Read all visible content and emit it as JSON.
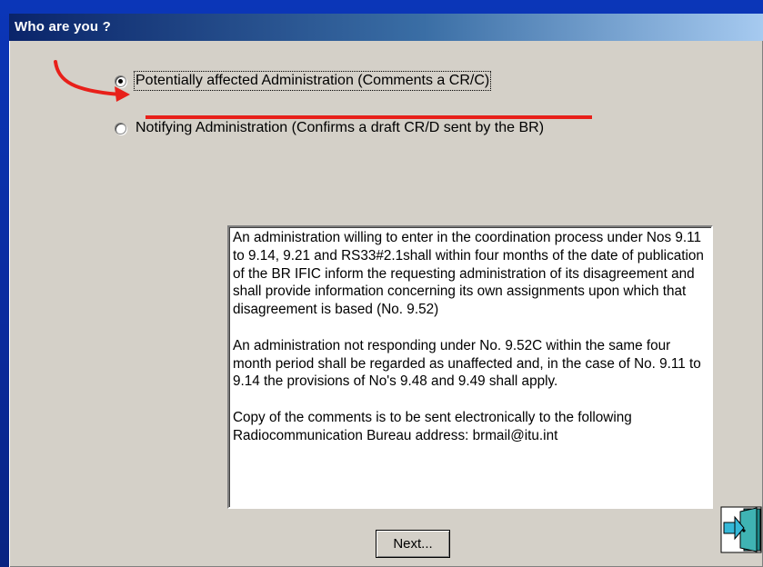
{
  "dialog": {
    "title": "Who are you ?"
  },
  "options": [
    {
      "label": "Potentially affected Administration (Comments a CR/C)",
      "checked": true
    },
    {
      "label": "Notifying Administration (Confirms a draft CR/D sent by the BR)",
      "checked": false
    }
  ],
  "info_text": {
    "paragraph_1": "An administration willing to enter in the coordination process under Nos 9.11 to 9.14, 9.21 and RS33#2.1shall within four months of the date of publication of the BR IFIC inform the requesting administration of its disagreement and shall provide information concerning its own assignments upon which that disagreement is based (No. 9.52)",
    "paragraph_2": "An administration not responding under No. 9.52C within the same four month period shall be regarded as unaffected and, in the case of No. 9.11 to 9.14 the provisions of No's 9.48 and 9.49 shall apply.",
    "paragraph_3": "Copy of the comments is to be sent electronically to the following Radiocommunication Bureau address: brmail@itu.int"
  },
  "buttons": {
    "next_label": "Next..."
  },
  "icons": {
    "exit": "exit-door-icon"
  },
  "annotation": {
    "color": "#e8201a"
  }
}
